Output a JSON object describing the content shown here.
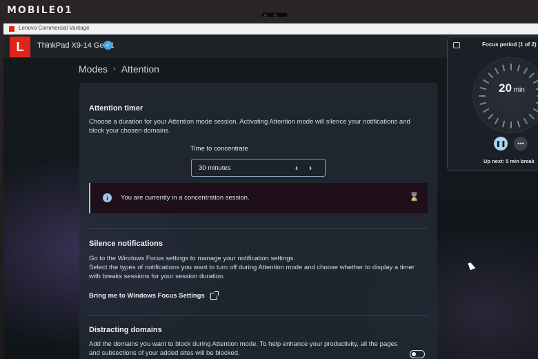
{
  "watermark": "MOBILE01",
  "window": {
    "title": "Lenovo Commercial Vantage"
  },
  "header": {
    "logo": "L",
    "device": "ThinkPad X9-14 Gen 1",
    "verified_icon": "check-circle-icon"
  },
  "breadcrumb": {
    "parent": "Modes",
    "separator": "›",
    "current": "Attention"
  },
  "attention_timer": {
    "title": "Attention timer",
    "description": "Choose a duration for your Attention mode session. Activating Attention mode will silence your notifications and block your chosen domains.",
    "time_label": "Time to concentrate",
    "value": "30 minutes",
    "prev": "‹",
    "next": "›"
  },
  "info": {
    "icon": "i",
    "message": "You are currently in a concentration session.",
    "status_icon": "⌛"
  },
  "silence": {
    "title": "Silence notifications",
    "line1": "Go to the Windows Focus settings to manage your notification settings.",
    "line2": "Select the types of notifications you want to turn off during Attention mode and choose whether to display a timer with breaks sessions for your session duration.",
    "link": "Bring me to Windows Focus Settings"
  },
  "domains": {
    "title": "Distracting domains",
    "description": "Add the domains you want to block during Attention mode. To help enhance your productivity, all the pages and subsections of your added sites will be blocked.",
    "toggle_on": false
  },
  "focus": {
    "title": "Focus period (1 of 2)",
    "time_value": "20",
    "time_unit": "min",
    "pause": "❚❚",
    "more": "•••",
    "upnext": "Up next: 5 min break"
  },
  "colors": {
    "accent": "#a7d6f1",
    "brand": "#e1251b",
    "panel": "#222a34"
  }
}
